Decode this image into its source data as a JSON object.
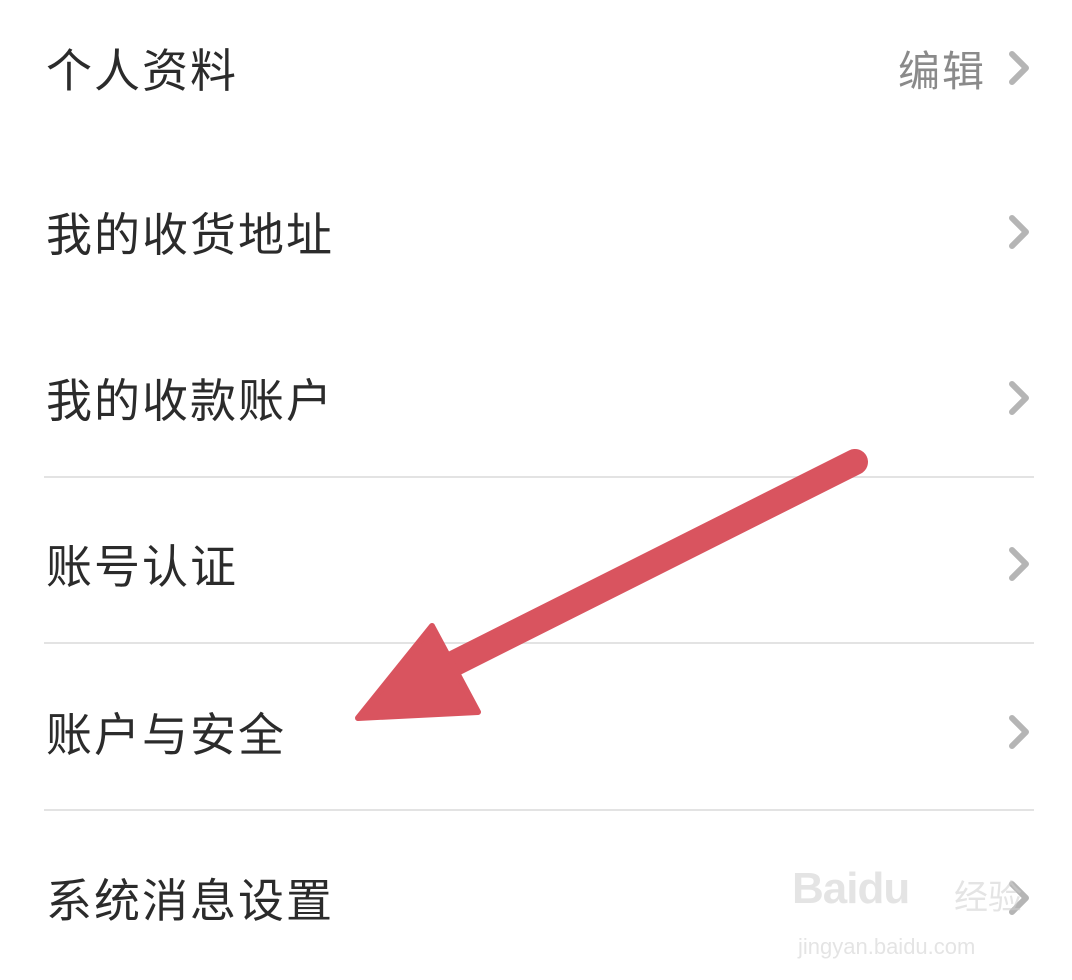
{
  "menu": {
    "items": [
      {
        "label": "个人资料",
        "right_text": "编辑"
      },
      {
        "label": "我的收货地址"
      },
      {
        "label": "我的收款账户"
      },
      {
        "label": "账号认证"
      },
      {
        "label": "账户与安全"
      },
      {
        "label": "系统消息设置"
      }
    ]
  },
  "annotation": {
    "arrow_color": "#d9545f"
  },
  "watermark": {
    "brand": "Baidu",
    "tag": "经验",
    "url": "jingyan.baidu.com"
  },
  "colors": {
    "text": "#2b2b2b",
    "muted": "#8a8a8a",
    "chevron": "#b5b5b5",
    "divider": "#e3e3e3"
  }
}
